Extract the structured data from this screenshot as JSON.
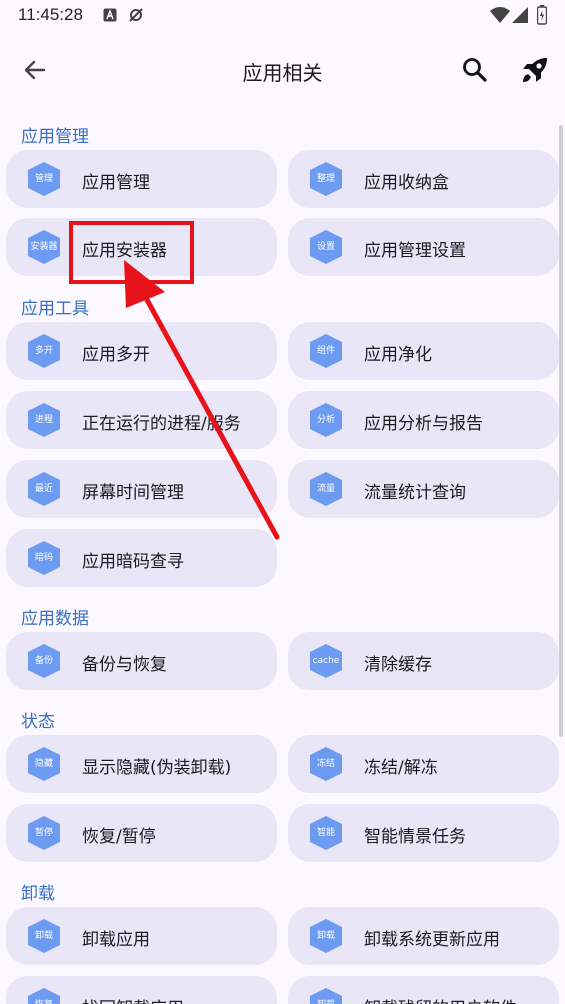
{
  "status_bar": {
    "time": "11:45:28"
  },
  "header": {
    "title": "应用相关"
  },
  "colors": {
    "accent": "#3a6fbf",
    "card_bg": "#e8e6f7",
    "icon_bg": "#6d9bf2",
    "highlight": "#e8121a"
  },
  "sections": [
    {
      "title": "应用管理",
      "items": [
        {
          "label": "应用管理",
          "icon_text": "管理"
        },
        {
          "label": "应用收纳盒",
          "icon_text": "整理"
        },
        {
          "label": "应用安装器",
          "icon_text": "安装器"
        },
        {
          "label": "应用管理设置",
          "icon_text": "设置"
        }
      ]
    },
    {
      "title": "应用工具",
      "items": [
        {
          "label": "应用多开",
          "icon_text": "多开"
        },
        {
          "label": "应用净化",
          "icon_text": "组件"
        },
        {
          "label": "正在运行的进程/服务",
          "icon_text": "进程"
        },
        {
          "label": "应用分析与报告",
          "icon_text": "分析"
        },
        {
          "label": "屏幕时间管理",
          "icon_text": "最近"
        },
        {
          "label": "流量统计查询",
          "icon_text": "流量"
        },
        {
          "label": "应用暗码查寻",
          "icon_text": "暗码"
        }
      ]
    },
    {
      "title": "应用数据",
      "items": [
        {
          "label": "备份与恢复",
          "icon_text": "备份"
        },
        {
          "label": "清除缓存",
          "icon_text": "cache"
        }
      ]
    },
    {
      "title": "状态",
      "items": [
        {
          "label": "显示隐藏(伪装卸载)",
          "icon_text": "隐藏"
        },
        {
          "label": "冻结/解冻",
          "icon_text": "冻结"
        },
        {
          "label": "恢复/暂停",
          "icon_text": "暂停"
        },
        {
          "label": "智能情景任务",
          "icon_text": "智能"
        }
      ]
    },
    {
      "title": "卸载",
      "items": [
        {
          "label": "卸载应用",
          "icon_text": "卸载"
        },
        {
          "label": "卸载系统更新应用",
          "icon_text": "卸载"
        },
        {
          "label": "找回卸载应用",
          "icon_text": "恢复"
        },
        {
          "label": "卸载残留的用户软件",
          "icon_text": "卸载"
        }
      ]
    }
  ]
}
